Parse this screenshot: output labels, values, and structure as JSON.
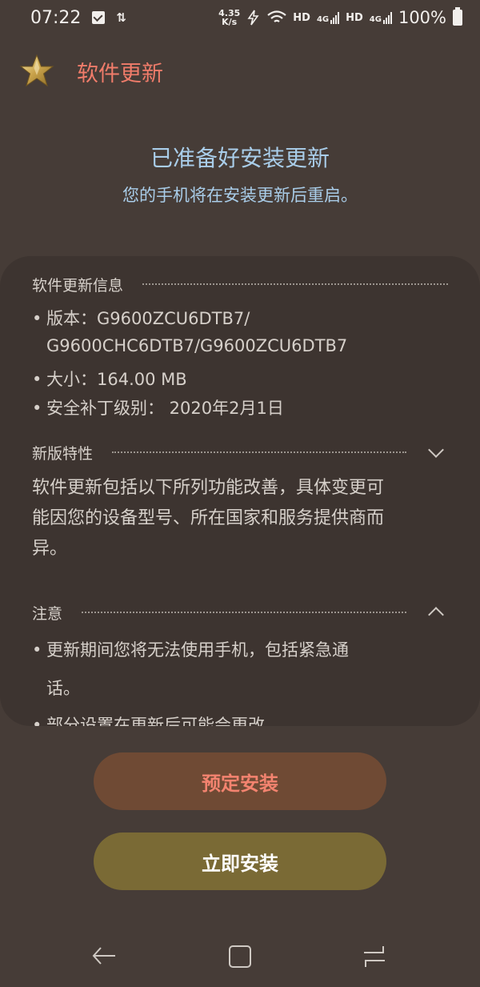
{
  "status_bar": {
    "time": "07:22",
    "net_speed_value": "4.35",
    "net_speed_unit": "K/s",
    "hd_label": "HD",
    "lte_label": "4G",
    "battery": "100%"
  },
  "header": {
    "title": "软件更新",
    "icon": "star-badge-icon"
  },
  "headline": "已准备好安装更新",
  "subline": "您的手机将在安装更新后重启。",
  "info_section": {
    "title": "软件更新信息",
    "version_line1": "版本：G9600ZCU6DTB7/",
    "version_line2": "G9600CHC6DTB7/G9600ZCU6DTB7",
    "size": "大小：164.00 MB",
    "security_patch": "安全补丁级别：  2020年2月1日"
  },
  "features_section": {
    "title": "新版特性",
    "body_line1": "软件更新包括以下所列功能改善，具体变更可",
    "body_line2": "能因您的设备型号、所在国家和服务提供商而",
    "body_line3": "异。"
  },
  "notes_section": {
    "title": "注意",
    "note1_line1": "更新期间您将无法使用手机，包括紧急通",
    "note1_line2": "话。",
    "note2_line1": "部分设置在更新后可能会更改。"
  },
  "buttons": {
    "schedule": "预定安装",
    "install_now": "立即安装"
  },
  "colors": {
    "background": "#463c37",
    "card": "#3d3430",
    "accent_title": "#f07c6a",
    "headline": "#a9cde9",
    "schedule_button": "#6f4a34",
    "install_button": "#7a6a35"
  }
}
